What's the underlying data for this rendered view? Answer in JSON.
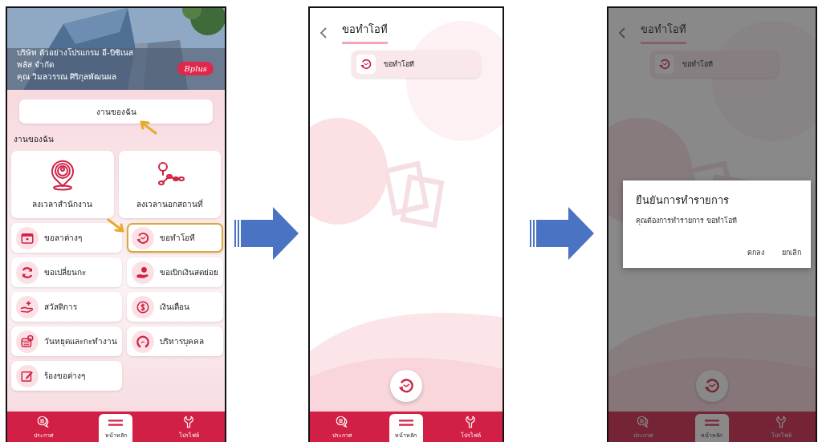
{
  "steps": [
    {
      "kind": "home",
      "company_name": "บริษัท ตัวอย่างโปรแกรม อี-บิซิเนส",
      "company_suffix": "พลัส จำกัด",
      "user_name": "คุณ วิมลวรรณ ศิริกุลพัฒนผล",
      "logo": "Bplus",
      "my_work_button": "งานของฉัน",
      "section_title": "งานของฉัน",
      "main_actions": [
        {
          "label": "ลงเวลาสำนักงาน"
        },
        {
          "label": "ลงเวลานอกสถานที่"
        }
      ],
      "menu_items": [
        {
          "label": "ขอลาต่างๆ",
          "highlighted": false
        },
        {
          "label": "ขอทำโอที",
          "highlighted": true
        },
        {
          "label": "ขอเปลี่ยนกะ",
          "highlighted": false
        },
        {
          "label": "ขอเบิกเงินสดย่อย",
          "highlighted": false
        },
        {
          "label": "สวัสดิการ",
          "highlighted": false
        },
        {
          "label": "เงินเดือน",
          "highlighted": false
        },
        {
          "label": "วันหยุดและกะทำงาน",
          "highlighted": false
        },
        {
          "label": "บริหารบุคคล",
          "highlighted": false
        },
        {
          "label": "ร้องขอต่างๆ",
          "highlighted": false
        }
      ],
      "nav": [
        {
          "label": "ประกาศ",
          "selected": false
        },
        {
          "label": "หน้าหลัก",
          "selected": true
        },
        {
          "label": "โปรไฟล์",
          "selected": false
        }
      ]
    },
    {
      "kind": "request",
      "title": "ขอทำโอที",
      "chip": "ขอทำโอที",
      "nav": [
        {
          "label": "ประกาศ",
          "selected": false
        },
        {
          "label": "หน้าหลัก",
          "selected": true
        },
        {
          "label": "โปรไฟล์",
          "selected": false
        }
      ]
    },
    {
      "kind": "request",
      "title": "ขอทำโอที",
      "chip": "ขอทำโอที",
      "dialog": {
        "title": "ยืนยันการทำรายการ",
        "message": "คุณต้องการทำรายการ ขอทำโอที",
        "buttons": [
          "ตกลง",
          "ยกเลิก"
        ]
      },
      "nav": [
        {
          "label": "ประกาศ",
          "selected": false
        },
        {
          "label": "หน้าหลัก",
          "selected": true
        },
        {
          "label": "โปรไฟล์",
          "selected": false
        }
      ]
    }
  ]
}
